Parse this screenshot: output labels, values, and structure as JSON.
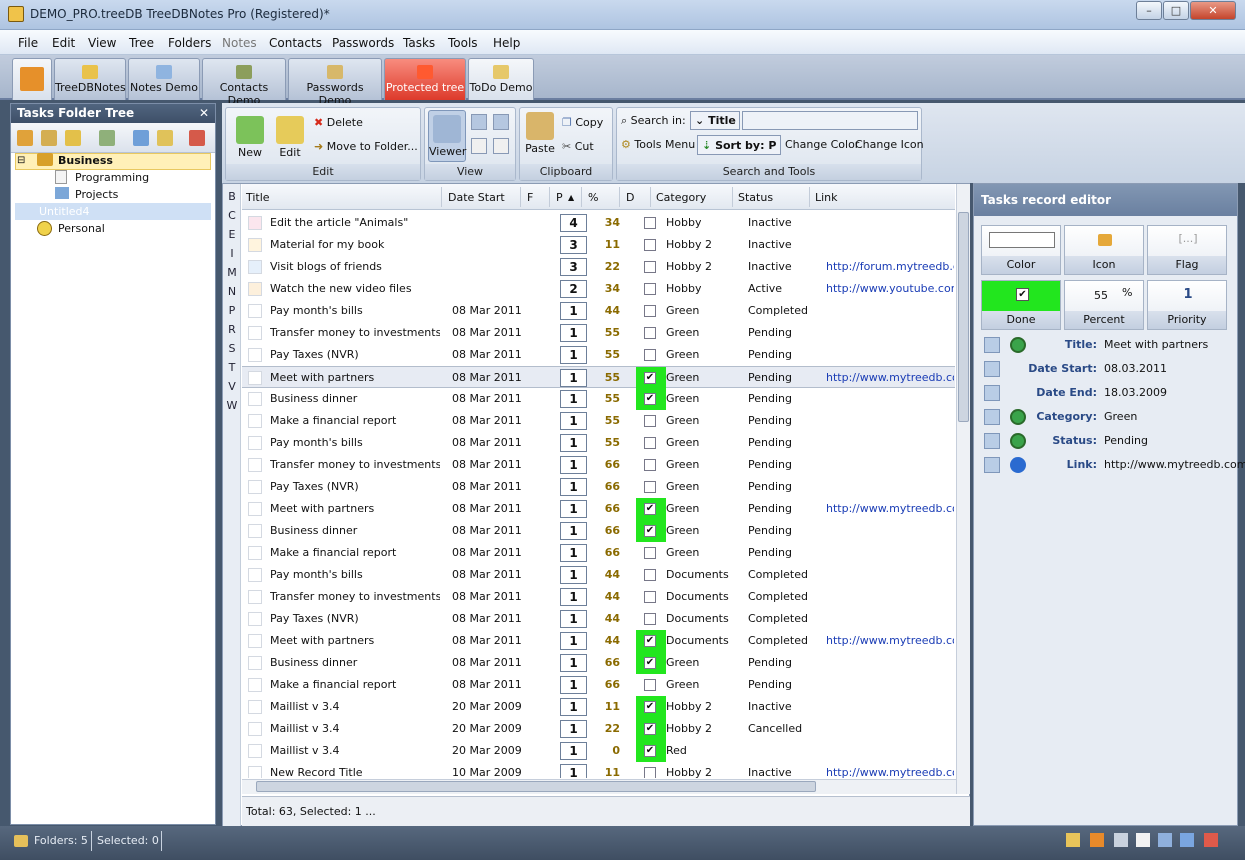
{
  "window": {
    "title": "DEMO_PRO.treeDB TreeDBNotes Pro (Registered)*",
    "min": "–",
    "max": "□",
    "close": "✕"
  },
  "menu": [
    "File",
    "Edit",
    "View",
    "Tree",
    "Folders",
    "Notes",
    "Contacts",
    "Passwords",
    "Tasks",
    "Tools",
    "Help"
  ],
  "tabs": [
    "TreeDBNotes",
    "Notes Demo",
    "Contacts Demo",
    "Passwords Demo",
    "Protected tree",
    "ToDo Demo"
  ],
  "left": {
    "title": "Tasks Folder Tree",
    "close": "✕",
    "nodes": [
      "Business",
      "Programming",
      "Projects",
      "Untitled4",
      "Personal"
    ]
  },
  "ribbon": {
    "new": "New",
    "edit": "Edit",
    "delete": "Delete",
    "move": "Move to Folder...",
    "g_edit": "Edit",
    "viewer": "Viewer",
    "g_view": "View",
    "paste": "Paste",
    "copy": "Copy",
    "cut": "Cut",
    "g_clip": "Clipboard",
    "search_in": "Search in:",
    "search_field": "Title",
    "tools_menu": "Tools Menu",
    "sort_by": "Sort by: P",
    "change_color": "Change Color",
    "change_icon": "Change Icon",
    "g_search": "Search and Tools"
  },
  "alpha": [
    "B",
    "C",
    "E",
    "I",
    "M",
    "N",
    "P",
    "R",
    "S",
    "T",
    "V",
    "W"
  ],
  "grid": {
    "headers": [
      "Title",
      "Date Start",
      "F",
      "P",
      "%",
      "D",
      "Category",
      "Status",
      "Link"
    ],
    "sort_arrow": "▲",
    "rows": [
      {
        "title": "Edit the article \"Animals\"",
        "date": "",
        "p": "4",
        "pct": "34",
        "done": false,
        "cat": "Hobby",
        "status": "Inactive",
        "link": "",
        "color": "#fbe6ee"
      },
      {
        "title": "Material for my book",
        "date": "",
        "p": "3",
        "pct": "11",
        "done": false,
        "cat": "Hobby 2",
        "status": "Inactive",
        "link": "",
        "color": "#fff4de"
      },
      {
        "title": "Visit blogs of friends",
        "date": "",
        "p": "3",
        "pct": "22",
        "done": false,
        "cat": "Hobby 2",
        "status": "Inactive",
        "link": "http://forum.mytreedb.com",
        "color": "#e6f0fb"
      },
      {
        "title": "Watch the new video files",
        "date": "",
        "p": "2",
        "pct": "34",
        "done": false,
        "cat": "Hobby",
        "status": "Active",
        "link": "http://www.youtube.com/",
        "color": "#fdf0dc"
      },
      {
        "title": "Pay month's bills",
        "date": "08 Mar 2011",
        "p": "1",
        "pct": "44",
        "done": false,
        "cat": "Green",
        "status": "Completed",
        "link": "",
        "color": "#fff"
      },
      {
        "title": "Transfer money to investments",
        "date": "08 Mar 2011",
        "p": "1",
        "pct": "55",
        "done": false,
        "cat": "Green",
        "status": "Pending",
        "link": "",
        "color": "#fff"
      },
      {
        "title": "Pay Taxes (NVR)",
        "date": "08 Mar 2011",
        "p": "1",
        "pct": "55",
        "done": false,
        "cat": "Green",
        "status": "Pending",
        "link": "",
        "color": "#fff"
      },
      {
        "title": "Meet with partners",
        "date": "08 Mar 2011",
        "p": "1",
        "pct": "55",
        "done": true,
        "cat": "Green",
        "status": "Pending",
        "link": "http://www.mytreedb.com",
        "color": "#fff"
      },
      {
        "title": "Business dinner",
        "date": "08 Mar 2011",
        "p": "1",
        "pct": "55",
        "done": true,
        "cat": "Green",
        "status": "Pending",
        "link": "",
        "color": "#fff"
      },
      {
        "title": "Make a financial report",
        "date": "08 Mar 2011",
        "p": "1",
        "pct": "55",
        "done": false,
        "cat": "Green",
        "status": "Pending",
        "link": "",
        "color": "#fff"
      },
      {
        "title": "Pay month's bills",
        "date": "08 Mar 2011",
        "p": "1",
        "pct": "55",
        "done": false,
        "cat": "Green",
        "status": "Pending",
        "link": "",
        "color": "#fff"
      },
      {
        "title": "Transfer money to investments",
        "date": "08 Mar 2011",
        "p": "1",
        "pct": "66",
        "done": false,
        "cat": "Green",
        "status": "Pending",
        "link": "",
        "color": "#fff"
      },
      {
        "title": "Pay Taxes (NVR)",
        "date": "08 Mar 2011",
        "p": "1",
        "pct": "66",
        "done": false,
        "cat": "Green",
        "status": "Pending",
        "link": "",
        "color": "#fff"
      },
      {
        "title": "Meet with partners",
        "date": "08 Mar 2011",
        "p": "1",
        "pct": "66",
        "done": true,
        "cat": "Green",
        "status": "Pending",
        "link": "http://www.mytreedb.com",
        "color": "#fff"
      },
      {
        "title": "Business dinner",
        "date": "08 Mar 2011",
        "p": "1",
        "pct": "66",
        "done": true,
        "cat": "Green",
        "status": "Pending",
        "link": "",
        "color": "#fff"
      },
      {
        "title": "Make a financial report",
        "date": "08 Mar 2011",
        "p": "1",
        "pct": "66",
        "done": false,
        "cat": "Green",
        "status": "Pending",
        "link": "",
        "color": "#fff"
      },
      {
        "title": "Pay month's bills",
        "date": "08 Mar 2011",
        "p": "1",
        "pct": "44",
        "done": false,
        "cat": "Documents",
        "status": "Completed",
        "link": "",
        "color": "#fff"
      },
      {
        "title": "Transfer money to investments",
        "date": "08 Mar 2011",
        "p": "1",
        "pct": "44",
        "done": false,
        "cat": "Documents",
        "status": "Completed",
        "link": "",
        "color": "#fff"
      },
      {
        "title": "Pay Taxes (NVR)",
        "date": "08 Mar 2011",
        "p": "1",
        "pct": "44",
        "done": false,
        "cat": "Documents",
        "status": "Completed",
        "link": "",
        "color": "#fff"
      },
      {
        "title": "Meet with partners",
        "date": "08 Mar 2011",
        "p": "1",
        "pct": "44",
        "done": true,
        "cat": "Documents",
        "status": "Completed",
        "link": "http://www.mytreedb.com",
        "color": "#fff"
      },
      {
        "title": "Business dinner",
        "date": "08 Mar 2011",
        "p": "1",
        "pct": "66",
        "done": true,
        "cat": "Green",
        "status": "Pending",
        "link": "",
        "color": "#fff"
      },
      {
        "title": "Make a financial report",
        "date": "08 Mar 2011",
        "p": "1",
        "pct": "66",
        "done": false,
        "cat": "Green",
        "status": "Pending",
        "link": "",
        "color": "#fff"
      },
      {
        "title": "Maillist v 3.4",
        "date": "20 Mar 2009",
        "p": "1",
        "pct": "11",
        "done": true,
        "cat": "Hobby 2",
        "status": "Inactive",
        "link": "",
        "color": "#fff"
      },
      {
        "title": "Maillist v 3.4",
        "date": "20 Mar 2009",
        "p": "1",
        "pct": "22",
        "done": true,
        "cat": "Hobby 2",
        "status": "Cancelled",
        "link": "",
        "color": "#fff"
      },
      {
        "title": "Maillist v 3.4",
        "date": "20 Mar 2009",
        "p": "1",
        "pct": "0",
        "done": true,
        "cat": "Red",
        "status": "",
        "link": "",
        "color": "#fff"
      },
      {
        "title": "New Record Title",
        "date": "10 Mar 2009",
        "p": "1",
        "pct": "11",
        "done": false,
        "cat": "Hobby 2",
        "status": "Inactive",
        "link": "http://www.mytreedb.com",
        "color": "#fff"
      }
    ],
    "total": "Total: 63, Selected: 1 ..."
  },
  "editor": {
    "title": "Tasks record editor",
    "tiles": {
      "color": "Color",
      "icon": "Icon",
      "flag": "Flag",
      "flag_val": "[...]",
      "done": "Done",
      "percent": "Percent",
      "percent_val": "55",
      "percent_sign": "%",
      "priority": "Priority",
      "priority_val": "1"
    },
    "fields": [
      {
        "label": "Title:",
        "value": "Meet with partners"
      },
      {
        "label": "Date Start:",
        "value": "08.03.2011"
      },
      {
        "label": "Date End:",
        "value": "18.03.2009"
      },
      {
        "label": "Category:",
        "value": "Green"
      },
      {
        "label": "Status:",
        "value": "Pending"
      },
      {
        "label": "Link:",
        "value": "http://www.mytreedb.com"
      }
    ]
  },
  "status": {
    "folders": "Folders: 5",
    "selected": "Selected: 0"
  },
  "colors": {
    "done_green": "#22e61e",
    "link_blue": "#1a3cb5",
    "pct_gold": "#8a6a00",
    "protected_red": "#dd3a2b"
  }
}
